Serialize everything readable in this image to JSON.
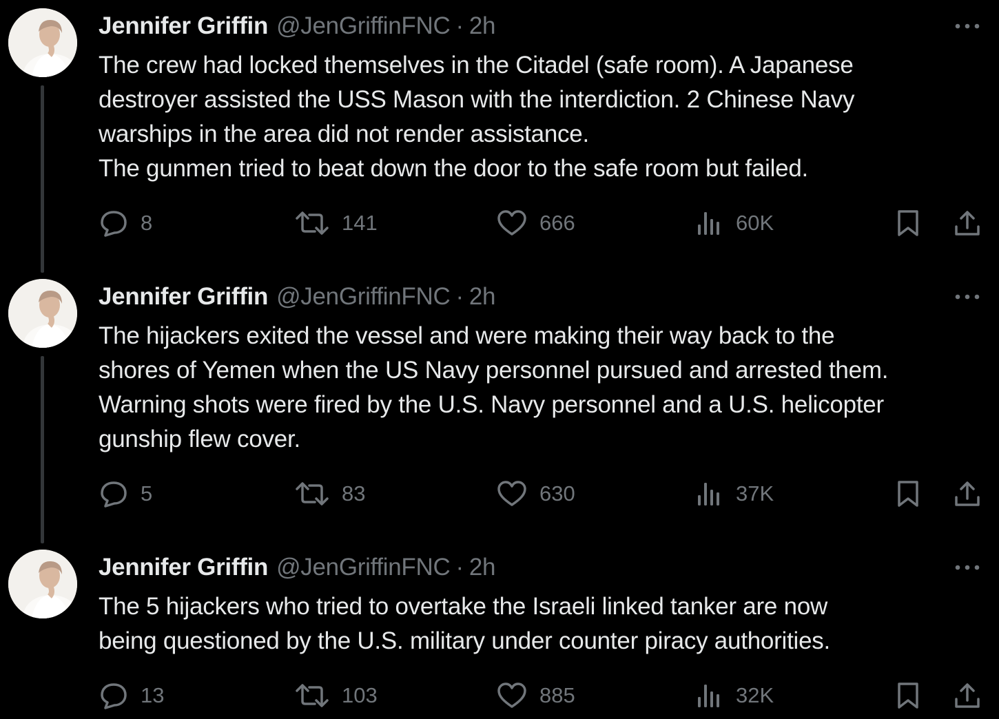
{
  "colors": {
    "background": "#000000",
    "primary_text": "#e7e9ea",
    "secondary_text": "#71767b",
    "thread_line": "#333639"
  },
  "icons": {
    "more": "three-dots-horizontal",
    "reply": "speech-bubble",
    "retweet": "retweet-arrows",
    "like": "heart-outline",
    "views": "bar-chart",
    "bookmark": "bookmark-outline",
    "share": "upload-arrow"
  },
  "tweets": [
    {
      "author_name": "Jennifer Griffin",
      "handle": "@JenGriffinFNC",
      "separator": "·",
      "time": "2h",
      "lines": [
        "The crew had locked themselves in the Citadel (safe room). A Japanese",
        "destroyer assisted the USS Mason with the interdiction. 2 Chinese  Navy",
        "warships in the area did not render assistance.",
        "The gunmen tried to beat down the door to the safe room but failed."
      ],
      "replies": "8",
      "retweets": "141",
      "likes": "666",
      "views": "60K"
    },
    {
      "author_name": "Jennifer Griffin",
      "handle": "@JenGriffinFNC",
      "separator": "·",
      "time": "2h",
      "lines": [
        "The hijackers exited the vessel and were making their way back to the",
        "shores of Yemen when the US Navy personnel pursued and arrested them.",
        "Warning shots were fired by the U.S. Navy personnel and a U.S. helicopter",
        "gunship flew cover."
      ],
      "replies": "5",
      "retweets": "83",
      "likes": "630",
      "views": "37K"
    },
    {
      "author_name": "Jennifer Griffin",
      "handle": "@JenGriffinFNC",
      "separator": "·",
      "time": "2h",
      "lines": [
        "The 5 hijackers who tried to overtake the Israeli linked tanker are now",
        "being questioned by the U.S. military under counter piracy authorities."
      ],
      "replies": "13",
      "retweets": "103",
      "likes": "885",
      "views": "32K"
    }
  ]
}
